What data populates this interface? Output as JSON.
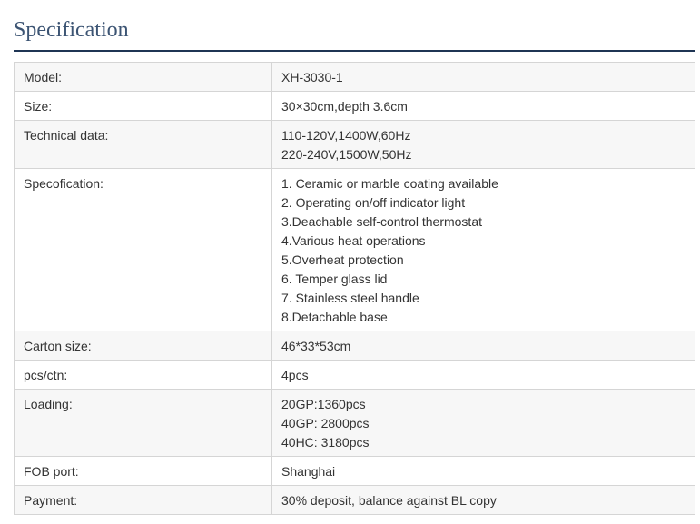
{
  "heading": "Specification",
  "rows": [
    {
      "label": "Model:",
      "lines": [
        "XH-3030-1"
      ]
    },
    {
      "label": "Size:",
      "lines": [
        "30×30cm,depth 3.6cm"
      ]
    },
    {
      "label": "Technical data:",
      "lines": [
        "110-120V,1400W,60Hz",
        "220-240V,1500W,50Hz"
      ]
    },
    {
      "label": "Specofication:",
      "lines": [
        "1. Ceramic or marble coating available",
        "2. Operating on/off indicator light",
        "3.Deachable self-control thermostat",
        "4.Various heat operations",
        "5.Overheat protection",
        "6. Temper glass lid",
        "7. Stainless steel handle",
        "8.Detachable base"
      ]
    },
    {
      "label": "Carton size:",
      "lines": [
        "46*33*53cm"
      ]
    },
    {
      "label": "pcs/ctn:",
      "lines": [
        "4pcs"
      ]
    },
    {
      "label": "Loading:",
      "lines": [
        "20GP:1360pcs",
        "40GP: 2800pcs",
        "40HC: 3180pcs"
      ]
    },
    {
      "label": "FOB port:",
      "lines": [
        "Shanghai"
      ]
    },
    {
      "label": "Payment:",
      "lines": [
        "30% deposit, balance against BL copy"
      ]
    }
  ]
}
